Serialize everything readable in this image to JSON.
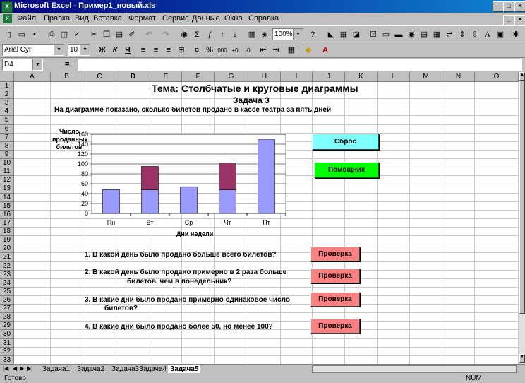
{
  "window": {
    "title": "Microsoft Excel - Пример1_новый.xls"
  },
  "menu": [
    "Файл",
    "Правка",
    "Вид",
    "Вставка",
    "Формат",
    "Сервис",
    "Данные",
    "Окно",
    "Справка"
  ],
  "toolbar": {
    "zoom": "100%"
  },
  "format_bar": {
    "font": "Arial Cyr",
    "size": "10"
  },
  "formula_bar": {
    "cell_ref": "D4",
    "eq": "=",
    "value": ""
  },
  "columns": [
    "A",
    "B",
    "C",
    "D",
    "E",
    "F",
    "G",
    "H",
    "I",
    "J",
    "K",
    "L",
    "M",
    "N",
    "O"
  ],
  "rows": [
    "1",
    "2",
    "3",
    "4",
    "5",
    "6",
    "7",
    "8",
    "9",
    "10",
    "11",
    "12",
    "13",
    "14",
    "15",
    "16",
    "17",
    "18",
    "19",
    "20",
    "21",
    "22",
    "23",
    "24",
    "25",
    "26",
    "27",
    "28",
    "29",
    "30",
    "31",
    "32",
    "33"
  ],
  "sheet": {
    "title": "Тема: Столбчатые и круговые диаграммы",
    "task": "Задача 3",
    "description": "На диаграмме показано, сколько билетов продано в кассе театра за пять дней",
    "q1": "1. В какой день было продано больше всего билетов?",
    "q2a": "2. В какой день было продано примерно в 2 раза больше",
    "q2b": "билетов, чем в понедельник?",
    "q3a": "3. В какие дни было продано примерно одинаковое число",
    "q3b": "билетов?",
    "q4": "4. В какие дни было продано более 50, но менее 100?"
  },
  "buttons": {
    "reset": "Сброс",
    "helper": "Помощник",
    "check": "Проверка"
  },
  "colors": {
    "reset": "#80ffff",
    "helper": "#00ff00",
    "check": "#ff8080",
    "bar": "#9999ff",
    "bar_top": "#993366"
  },
  "chart_data": {
    "type": "bar",
    "categories": [
      "Пн",
      "Вт",
      "Ср",
      "Чт",
      "Пт"
    ],
    "series": [
      {
        "values": [
          48,
          48,
          54,
          48,
          150
        ]
      },
      {
        "values": [
          0,
          47,
          0,
          54,
          0
        ]
      }
    ],
    "stacked": true,
    "ylabel": "Число проданных билетов",
    "xlabel": "Дни недели",
    "ylim": [
      0,
      160
    ],
    "yticks": [
      "0",
      "20",
      "40",
      "60",
      "80",
      "100",
      "120",
      "140",
      "160"
    ],
    "grid": true
  },
  "tabs": [
    "Задача1",
    "Задача2",
    "Задача3",
    "Задача4",
    "Задача5"
  ],
  "active_tab": "Задача5",
  "status": {
    "ready": "Готово",
    "num": "NUM"
  }
}
